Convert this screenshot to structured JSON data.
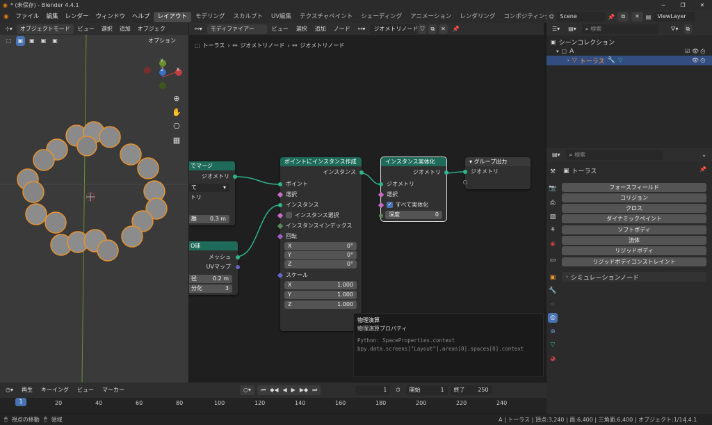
{
  "window": {
    "title": "* (未保存) - Blender 4.4.1"
  },
  "menu": {
    "file": "ファイル",
    "edit": "編集",
    "render": "レンダー",
    "window": "ウィンドウ",
    "help": "ヘルプ"
  },
  "workspaces": [
    "レイアウト",
    "モデリング",
    "スカルプト",
    "UV編集",
    "テクスチャペイント",
    "シェーディング",
    "アニメーション",
    "レンダリング",
    "コンポジティング"
  ],
  "scene": {
    "name": "Scene",
    "viewlayer": "ViewLayer"
  },
  "viewport": {
    "mode": "オブジェクトモード",
    "menus": [
      "ビュー",
      "選択",
      "追加",
      "オブジェク"
    ],
    "options": "オプション",
    "axes": {
      "x": "X",
      "y": "Y",
      "z": "Z"
    }
  },
  "node_editor": {
    "type": "モディファイアー",
    "menus": [
      "ビュー",
      "選択",
      "追加",
      "ノード"
    ],
    "tree_name": "ジオメトリノード",
    "breadcrumb": [
      "トーラス",
      "ジオメトリノード",
      "ジオメトリノード"
    ],
    "nodes": {
      "merge": {
        "title": "でマージ",
        "out_geometry": "ジオメトリ",
        "dropdown": "て",
        "row1": "トリ",
        "dist_label": "離",
        "dist_value": "0.3 m"
      },
      "sphere": {
        "title": "O球",
        "out_mesh": "メッシュ",
        "out_uv": "UVマップ",
        "radius_label": "径",
        "radius_value": "0.2 m",
        "subdiv_label": "分化",
        "subdiv_value": "3"
      },
      "instance_on_points": {
        "title": "ポイントにインスタンス作成",
        "out_instances": "インスタンス",
        "in_points": "ポイント",
        "in_selection": "選択",
        "in_instance": "インスタンス",
        "in_select_instance": "インスタンス選択",
        "in_instance_index": "インスタンスインデックス",
        "in_rotation": "回転",
        "rot_x": "0°",
        "rot_y": "0°",
        "rot_z": "0°",
        "in_scale": "スケール",
        "scale_x": "1.000",
        "scale_y": "1.000",
        "scale_z": "1.000",
        "lx": "X",
        "ly": "Y",
        "lz": "Z"
      },
      "realize": {
        "title": "インスタンス実体化",
        "out_geometry": "ジオメトリ",
        "in_geometry": "ジオメトリ",
        "in_selection": "選択",
        "realize_all": "すべて実体化",
        "depth_label": "深度",
        "depth_value": "0"
      },
      "group_output": {
        "title": "グループ出力",
        "in_geometry": "ジオメトリ"
      }
    },
    "tooltip": {
      "title": "物理演算",
      "subtitle": "物理演算プロパティ",
      "python1": "Python: SpaceProperties.context",
      "python2": "bpy.data.screens[\"Layout\"].areas[0].spaces[0].context"
    }
  },
  "outliner": {
    "search_placeholder": "検索",
    "collection": "シーンコレクション",
    "sub": "A",
    "object": "トーラス"
  },
  "properties": {
    "search_placeholder": "検索",
    "object": "トーラス",
    "buttons": [
      "フォースフィールド",
      "コリジョン",
      "クロス",
      "ダイナミックペイント",
      "ソフトボディ",
      "流体",
      "リジッドボディ",
      "リジッドボディコンストレイント"
    ],
    "sim_nodes": "シミュレーションノード"
  },
  "timeline": {
    "playback": "再生",
    "keying": "キーイング",
    "view": "ビュー",
    "marker": "マーカー",
    "current_frame": "1",
    "start_label": "開始",
    "start": "1",
    "end_label": "終了",
    "end": "250",
    "ticks": [
      "1",
      "20",
      "40",
      "60",
      "80",
      "100",
      "120",
      "140",
      "160",
      "180",
      "200",
      "220",
      "240"
    ]
  },
  "status": {
    "left1": "視点の移動",
    "left2": "領域",
    "right": "A | トーラス | 頂点:3,240 | 面:6,400 | 三角面:6,400 | オブジェクト:1/1 |",
    "version": "4.4.1"
  },
  "colors": {
    "node_header": "#1f6b59",
    "select_blue": "#334d80",
    "accent": "#4772b3"
  }
}
